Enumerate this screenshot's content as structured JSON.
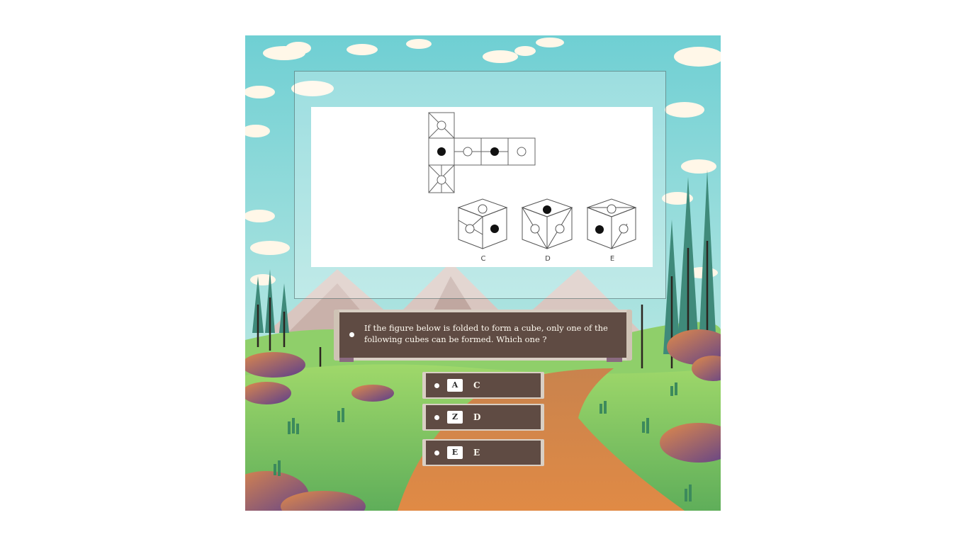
{
  "question": {
    "text": "If the figure below is folded to form a cube, only one of the following cubes can be formed. Which one ?"
  },
  "figure": {
    "cube_labels": [
      "C",
      "D",
      "E"
    ]
  },
  "options": [
    {
      "key": "A",
      "text": "C"
    },
    {
      "key": "Z",
      "text": "D"
    },
    {
      "key": "E",
      "text": "E"
    }
  ],
  "colors": {
    "board": "#5f4b43",
    "board_edge": "#d9cfc4",
    "sky": "#7dd3d6",
    "grass": "#7cc566",
    "path": "#d88a4c"
  }
}
